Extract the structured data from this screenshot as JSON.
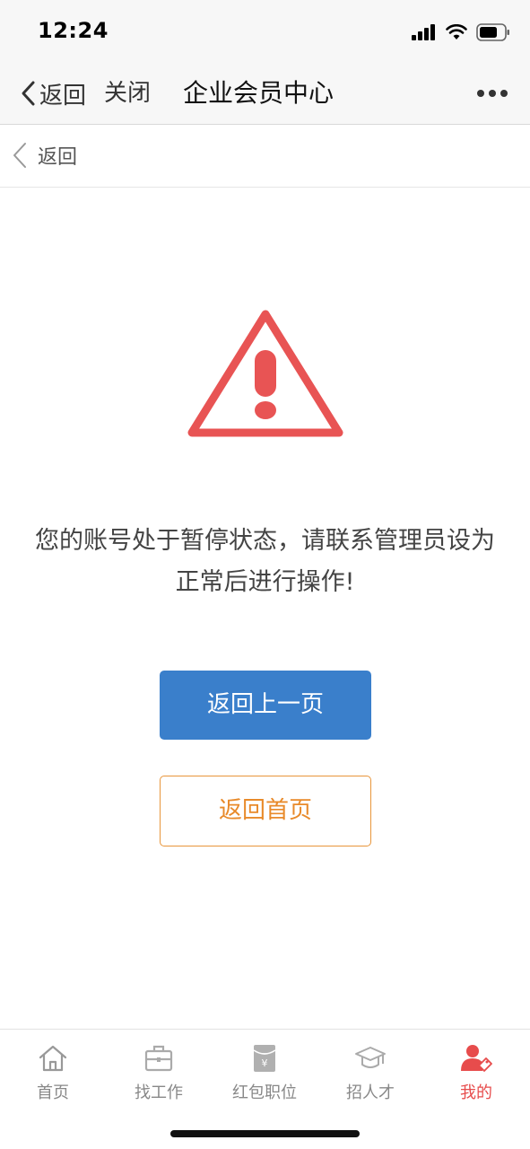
{
  "status_bar": {
    "time": "12:24",
    "icons": [
      "signal-icon",
      "wifi-icon",
      "battery-icon"
    ]
  },
  "nav": {
    "back_label": "返回",
    "close_label": "关闭",
    "title": "企业会员中心",
    "more_icon": "more-icon"
  },
  "page": {
    "back_label": "返回"
  },
  "warning": {
    "icon": "warning-icon",
    "color": "#e85454",
    "message_line1": "您的账号处于暂停状态，请联系管理员设为",
    "message_line2": "正常后进行操作!"
  },
  "buttons": {
    "back_previous": "返回上一页",
    "back_home": "返回首页",
    "primary_color": "#3a7fcb",
    "outline_color": "#e8953a"
  },
  "tabs": [
    {
      "label": "首页",
      "icon": "home-icon",
      "active": false
    },
    {
      "label": "找工作",
      "icon": "briefcase-icon",
      "active": false
    },
    {
      "label": "红包职位",
      "icon": "red-envelope-icon",
      "active": false
    },
    {
      "label": "招人才",
      "icon": "graduation-cap-icon",
      "active": false
    },
    {
      "label": "我的",
      "icon": "profile-icon",
      "active": true
    }
  ],
  "colors": {
    "active_tab": "#e74c4c",
    "inactive_tab": "#888888"
  }
}
